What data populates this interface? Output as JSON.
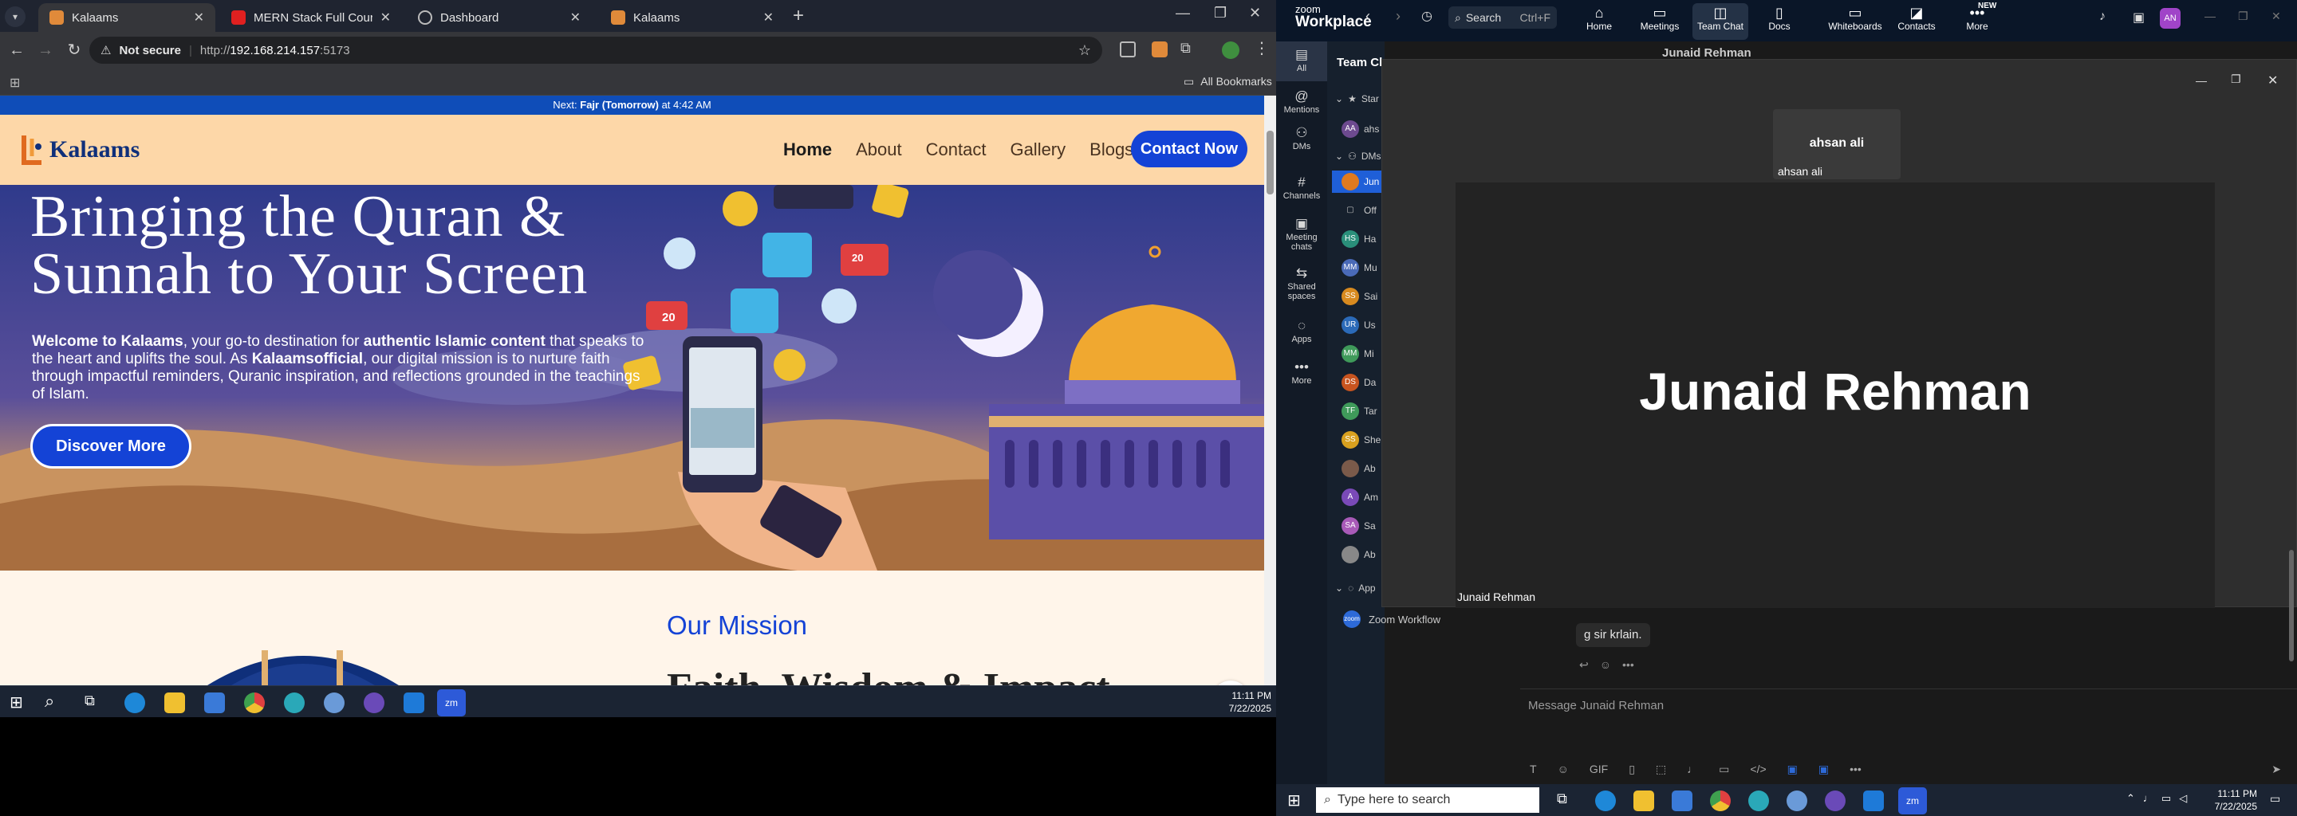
{
  "left": {
    "tabs": [
      {
        "title": "Kalaams",
        "active": true
      },
      {
        "title": "MERN Stack Full Course - ECom",
        "active": false
      },
      {
        "title": "Dashboard",
        "active": false
      },
      {
        "title": "Kalaams",
        "active": false
      }
    ],
    "address": {
      "security": "Not secure",
      "url_prefix": "http://",
      "host": "192.168.214.157",
      "port": ":5173"
    },
    "bookmarks_label": "All Bookmarks",
    "site": {
      "prayer_prefix": "Next: ",
      "prayer_name": "Fajr (Tomorrow)",
      "prayer_suffix": " at 4:42 AM",
      "logo_text": "Kalaams",
      "nav": [
        "Home",
        "About",
        "Contact",
        "Gallery",
        "Blogs"
      ],
      "contact_button": "Contact Now",
      "hero_title_1": "Bringing the Quran &",
      "hero_title_2": "Sunnah to Your Screen",
      "hero_p": {
        "a": "Welcome to Kalaams",
        "b": ", your go-to destination for ",
        "c": "authentic Islamic content",
        "d": " that speaks to the heart and uplifts the soul. As ",
        "e": "Kalaamsofficial",
        "f": ", our digital mission is to nurture faith through impactful reminders, Quranic inspiration, and reflections grounded in the teachings of Islam."
      },
      "discover_button": "Discover More",
      "badge_like": "20",
      "badge_comment": "20",
      "mission_title": "Our Mission",
      "mission_heading": "Faith, Wisdom & Impact"
    },
    "clock": {
      "time": "11:11 PM",
      "date": "7/22/2025"
    }
  },
  "zoom": {
    "brand_top": "zoom",
    "brand_bottom": "Workplace",
    "search_label": "Search",
    "search_shortcut": "Ctrl+F",
    "nav": [
      {
        "label": "Home",
        "icon": "home-icon"
      },
      {
        "label": "Meetings",
        "icon": "meetings-icon"
      },
      {
        "label": "Team Chat",
        "icon": "chat-icon"
      },
      {
        "label": "Docs",
        "icon": "docs-icon"
      },
      {
        "label": "Whiteboards",
        "icon": "whiteboard-icon"
      },
      {
        "label": "Contacts",
        "icon": "contacts-icon"
      },
      {
        "label": "More",
        "icon": "more-icon"
      }
    ],
    "new_badge": "NEW",
    "avatar_initials": "AN",
    "rail": [
      "All",
      "Mentions",
      "DMs",
      "Channels",
      "Meeting chats",
      "Shared spaces",
      "Apps",
      "More"
    ],
    "list_header": "Team Ch",
    "list_starred": "Star",
    "list_dms": "DMs",
    "list_items": [
      {
        "initials": "AA",
        "text": "ahs",
        "color": "#6d4a8f"
      },
      {
        "initials": "",
        "text": "Jun",
        "color": "#e07a1f"
      },
      {
        "initials": "",
        "text": "Off",
        "color": "#555555"
      },
      {
        "initials": "HS",
        "text": "Ha",
        "color": "#2a8f7a"
      },
      {
        "initials": "MM",
        "text": "Mu",
        "color": "#4a6ab8"
      },
      {
        "initials": "SS",
        "text": "Sai",
        "color": "#d88a1f"
      },
      {
        "initials": "UR",
        "text": "Us",
        "color": "#2b6ab8"
      },
      {
        "initials": "MM",
        "text": "Mi",
        "color": "#3f9a5a"
      },
      {
        "initials": "DS",
        "text": "Da",
        "color": "#c7541f"
      },
      {
        "initials": "TF",
        "text": "Tar",
        "color": "#3f9a5a"
      },
      {
        "initials": "SS",
        "text": "She",
        "color": "#d8a01f"
      },
      {
        "initials": "",
        "text": "Ab",
        "color": "#7a5a4a"
      },
      {
        "initials": "A",
        "text": "Am",
        "color": "#7a4ab8"
      },
      {
        "initials": "SA",
        "text": "Sa",
        "color": "#a85ab8"
      },
      {
        "initials": "",
        "text": "Ab",
        "color": "#888888"
      }
    ],
    "list_apps": "App",
    "zoom_workflow": "Zoom Workflow",
    "chat_header": "Junaid Rehman",
    "video": {
      "small_name_center": "ahsan ali",
      "small_name_label": "ahsan ali",
      "main_name": "Junaid Rehman",
      "main_label": "Junaid Rehman"
    },
    "message": "g sir krlain.",
    "compose_placeholder": "Message Junaid Rehman",
    "taskbar_search": "Type here to search",
    "clock": {
      "time": "11:11 PM",
      "date": "7/22/2025"
    }
  }
}
